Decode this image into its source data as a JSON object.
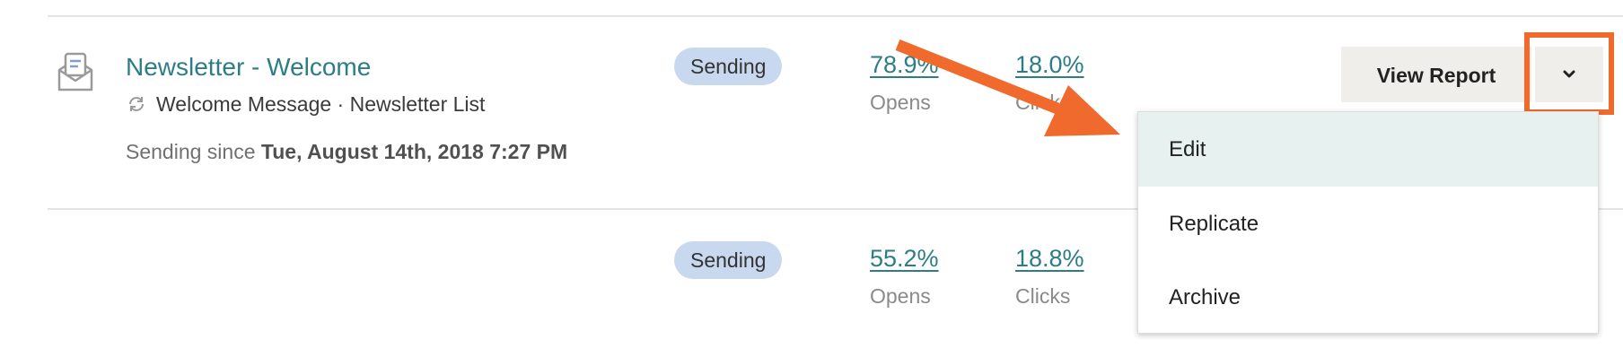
{
  "campaigns": [
    {
      "title": "Newsletter - Welcome",
      "subtitle": "Welcome Message · Newsletter List",
      "since_prefix": "Sending since ",
      "since_date": "Tue, August 14th, 2018 7:27 PM",
      "status": "Sending",
      "opens_value": "78.9%",
      "opens_label": "Opens",
      "clicks_value": "18.0%",
      "clicks_label": "Clicks"
    },
    {
      "status": "Sending",
      "opens_value": "55.2%",
      "opens_label": "Opens",
      "clicks_value": "18.8%",
      "clicks_label": "Clicks"
    }
  ],
  "actions": {
    "view_report_label": "View Report",
    "caret_icon": "chevron-down-icon"
  },
  "dropdown": {
    "items": [
      "Edit",
      "Replicate",
      "Archive"
    ],
    "active_index": 0
  },
  "annotation": {
    "color": "#ef6a2c"
  },
  "colors": {
    "link": "#2d7d86",
    "badge_bg": "#c8d8ee",
    "button_bg": "#efeeea",
    "menu_active_bg": "#e6f1f0"
  }
}
